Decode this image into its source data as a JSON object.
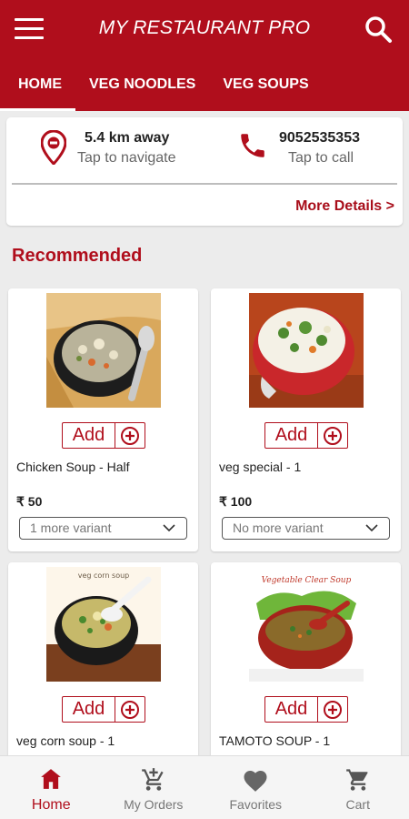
{
  "app": {
    "title": "MY RESTAURANT PRO"
  },
  "tabs": [
    {
      "label": "HOME",
      "active": true
    },
    {
      "label": "VEG NOODLES",
      "active": false
    },
    {
      "label": "VEG SOUPS",
      "active": false
    }
  ],
  "info": {
    "distance": "5.4 km away",
    "navigate_label": "Tap to navigate",
    "phone": "9052535353",
    "call_label": "Tap to call",
    "more_details": "More Details >"
  },
  "section_title": "Recommended",
  "add_label": "Add",
  "items": [
    {
      "name": "Chicken Soup - Half",
      "price": "₹ 50",
      "variant": "1 more variant",
      "image": "chicken-soup-photo"
    },
    {
      "name": "veg special - 1",
      "price": "₹ 100",
      "variant": "No more variant",
      "image": "veg-special-photo"
    },
    {
      "name": "veg corn soup - 1",
      "image": "veg-corn-soup-photo",
      "image_caption": "veg corn soup"
    },
    {
      "name": "TAMOTO SOUP - 1",
      "image": "tamoto-soup-photo",
      "image_caption": "Vegetable Clear Soup"
    }
  ],
  "bottom_nav": [
    {
      "label": "Home",
      "icon": "home-icon",
      "active": true
    },
    {
      "label": "My Orders",
      "icon": "cart-plus-icon",
      "active": false
    },
    {
      "label": "Favorites",
      "icon": "heart-icon",
      "active": false
    },
    {
      "label": "Cart",
      "icon": "cart-icon",
      "active": false
    }
  ],
  "colors": {
    "primary": "#b00e1c",
    "background": "#ececec",
    "text": "#222222"
  }
}
